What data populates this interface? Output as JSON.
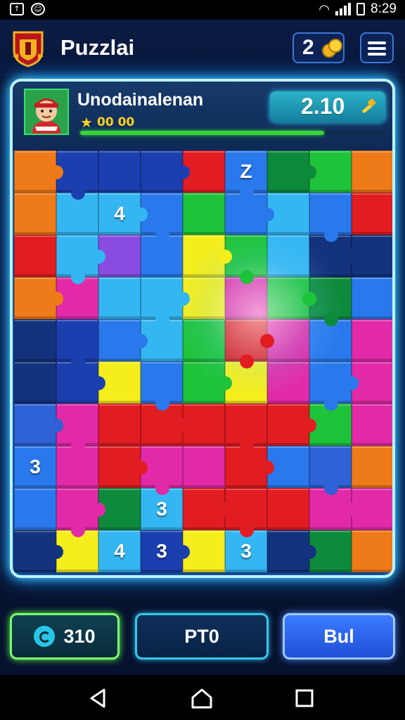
{
  "status_bar": {
    "time": "8:29"
  },
  "header": {
    "title": "Puzzlai",
    "coins": "2"
  },
  "player": {
    "name": "Unodainalenan",
    "stars": "00 00",
    "progress": 0.8,
    "score": "2.10"
  },
  "board": {
    "cols": 9,
    "rows": 10,
    "colors": {
      "O": "#ef7a1a",
      "D": "#1c3fb0",
      "B": "#2a79ec",
      "C": "#34b6f2",
      "L": "#1ea0ea",
      "R": "#e21d22",
      "G": "#1fc33a",
      "K": "#0e8a3c",
      "P": "#8a4ce0",
      "M": "#e22aa8",
      "Y": "#f6ee1c",
      "N": "#13337e",
      "T": "#1b9aa8",
      "A": "#2e62d6",
      "W": "#5fe6f0"
    },
    "layout": [
      "ODDDRBKGO",
      "OCCBGBCBR",
      "RCPBYGCNN",
      "OMCCYMGKB",
      "NDBCGRMBM",
      "NDYBGYMBM",
      "AMRRRRRGM",
      "BMRMMRBAO",
      "BMKCRRRMM",
      "NYCDYCNKO"
    ],
    "labels": [
      {
        "row": 0,
        "col": 5,
        "text": "Z"
      },
      {
        "row": 1,
        "col": 2,
        "text": "4"
      },
      {
        "row": 7,
        "col": 0,
        "text": "3"
      },
      {
        "row": 8,
        "col": 3,
        "text": "3"
      },
      {
        "row": 9,
        "col": 2,
        "text": "4"
      },
      {
        "row": 9,
        "col": 3,
        "text": "3"
      },
      {
        "row": 9,
        "col": 5,
        "text": "3"
      }
    ]
  },
  "buttons": {
    "hint_value": "310",
    "middle": "PT0",
    "right": "Bul"
  }
}
